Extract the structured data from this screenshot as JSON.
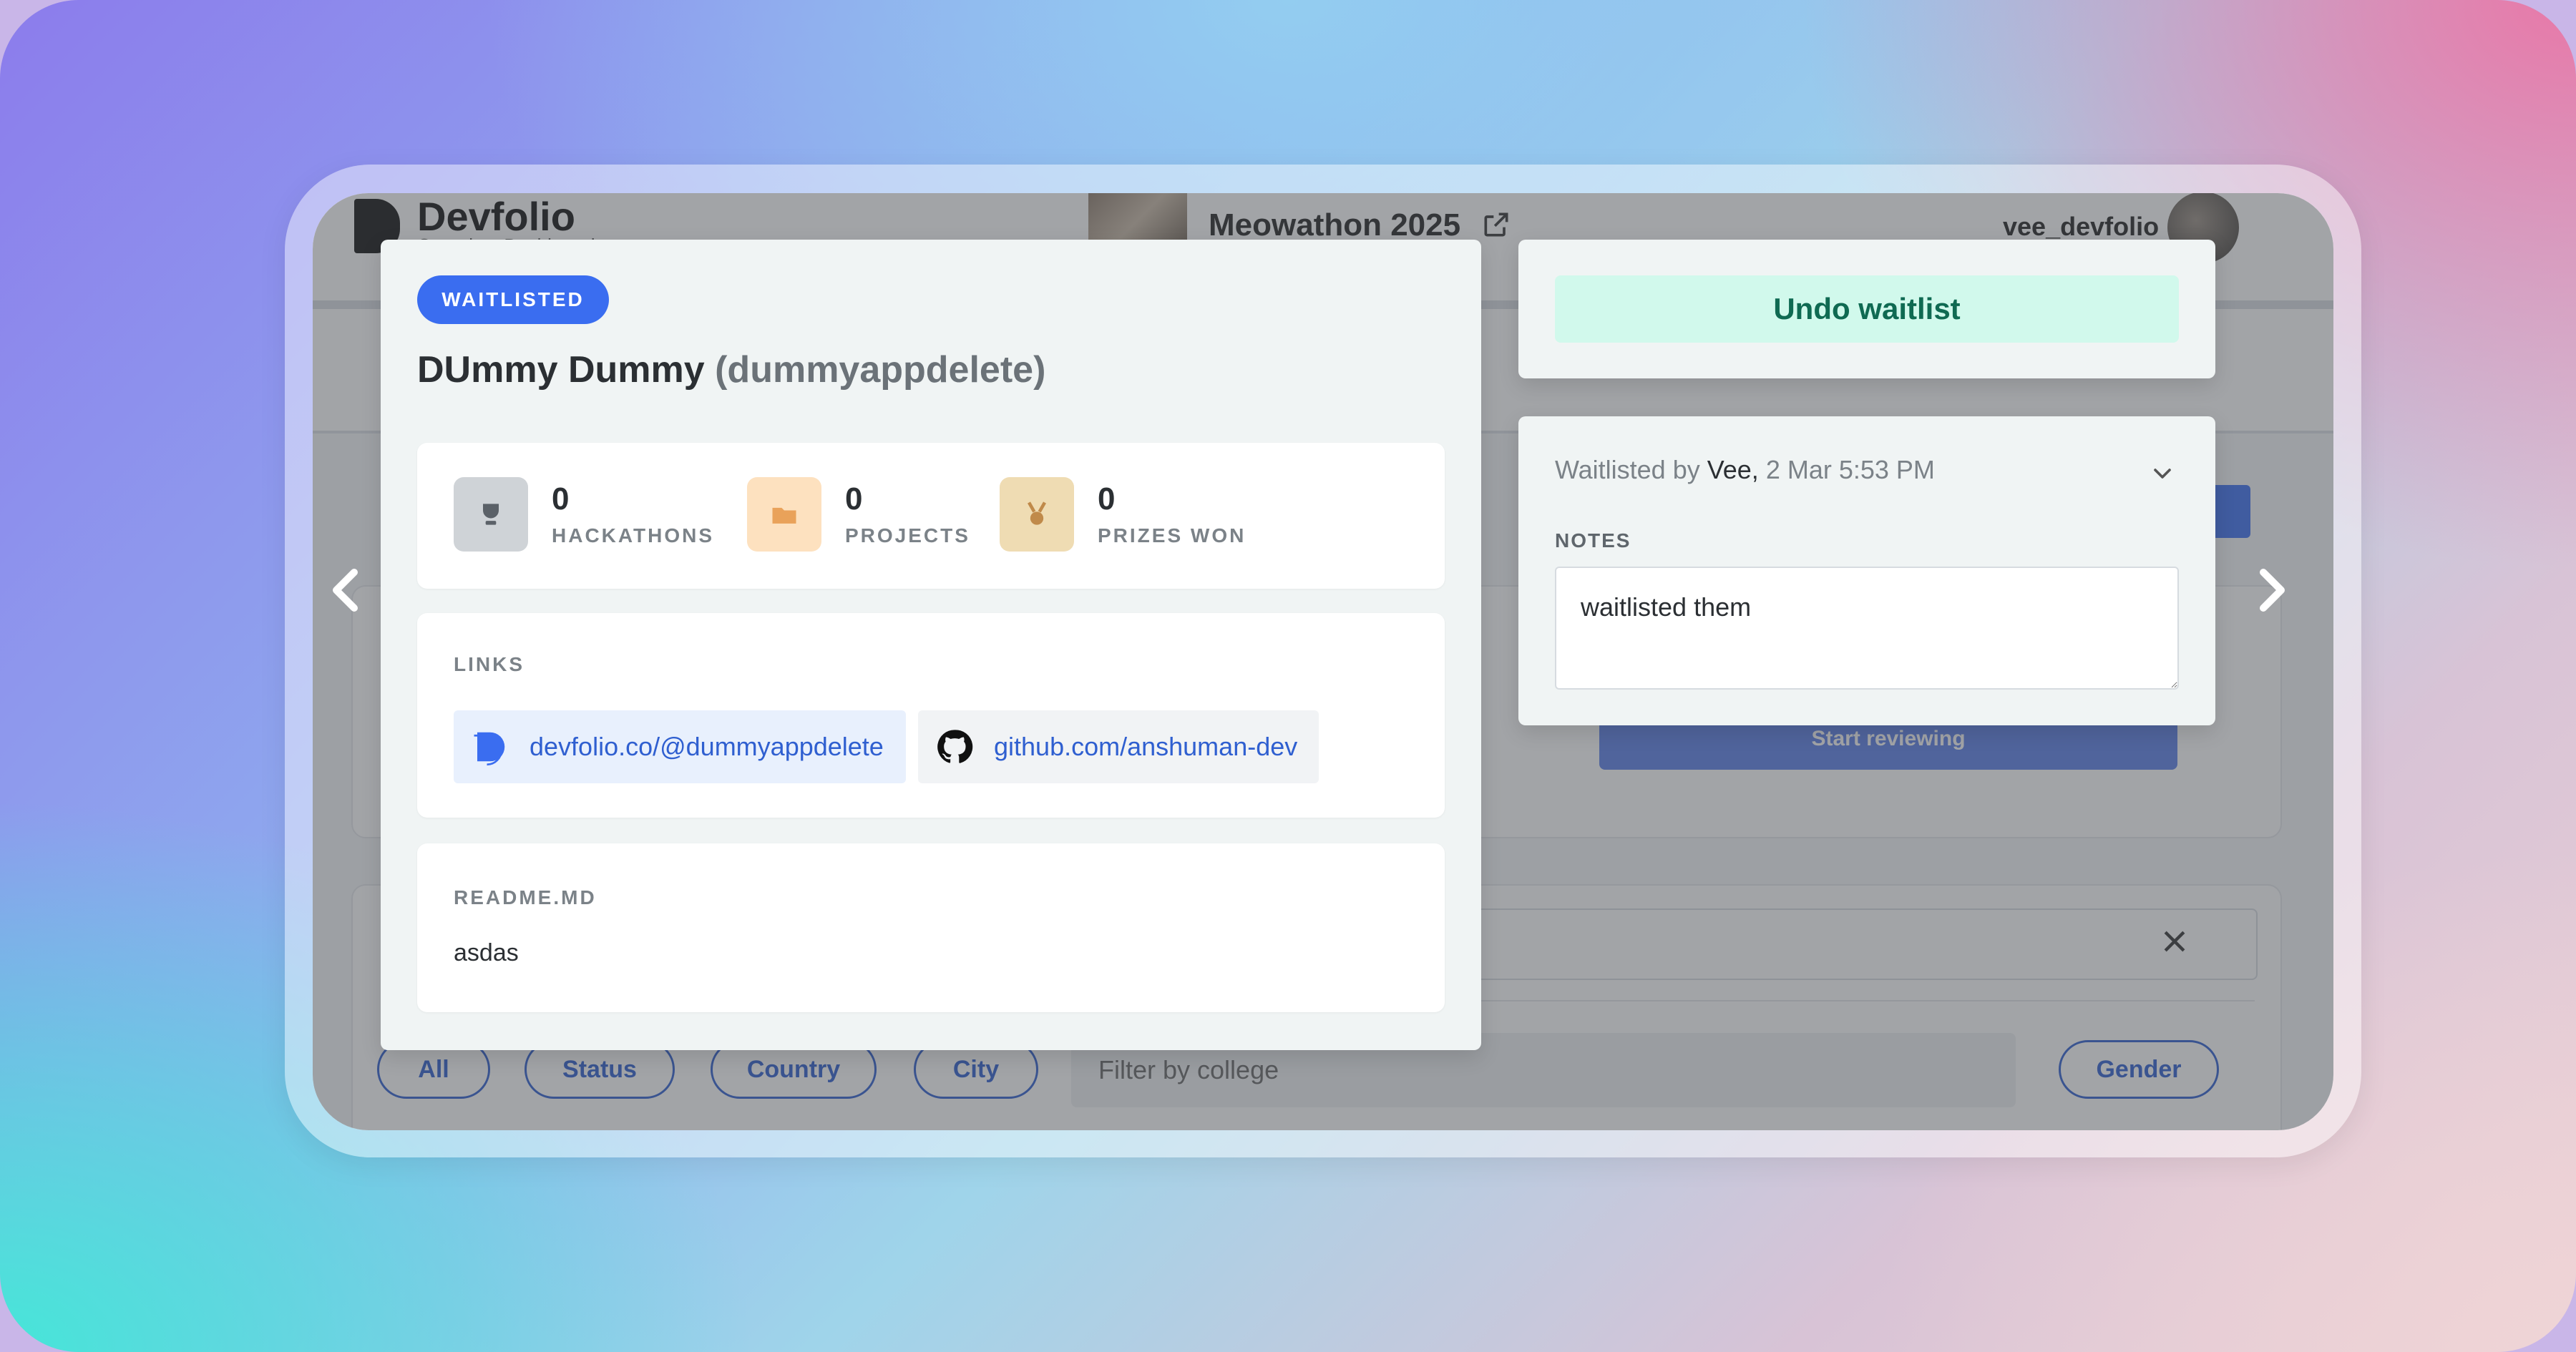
{
  "app": {
    "brand_name": "Devfolio",
    "brand_subtitle": "Organizer Dashboard",
    "event_name": "Meowathon 2025",
    "username": "vee_devfolio"
  },
  "background_page": {
    "start_review_label": "Start reviewing",
    "filters": [
      "All",
      "Status",
      "Country",
      "City"
    ],
    "college_placeholder": "Filter by college",
    "gender_label": "Gender"
  },
  "applicant": {
    "status_badge": "WAITLISTED",
    "full_name": "DUmmy Dummy",
    "handle": "(dummyappdelete)",
    "stats": [
      {
        "value": "0",
        "label": "HACKATHONS",
        "icon": "trophy-icon",
        "color": "#cfd3d7"
      },
      {
        "value": "0",
        "label": "PROJECTS",
        "icon": "folder-icon",
        "color": "#fde1bf"
      },
      {
        "value": "0",
        "label": "PRIZES WON",
        "icon": "medal-icon",
        "color": "#efdcb3"
      }
    ],
    "links_label": "LINKS",
    "links": [
      {
        "text": "devfolio.co/@dummyappdelete",
        "icon": "devfolio-icon"
      },
      {
        "text": "github.com/anshuman-dev",
        "icon": "github-icon"
      }
    ],
    "readme_label": "README.MD",
    "readme_text": "asdas"
  },
  "actions": {
    "undo_label": "Undo waitlist"
  },
  "review": {
    "prefix": "Waitlisted by ",
    "reviewer": "Vee,",
    "timestamp": " 2 Mar 5:53 PM",
    "notes_label": "NOTES",
    "notes_value": "waitlisted them"
  },
  "colors": {
    "accent": "#3a6df0",
    "undo_bg": "#d1f9ec",
    "undo_text": "#0f6a52"
  }
}
